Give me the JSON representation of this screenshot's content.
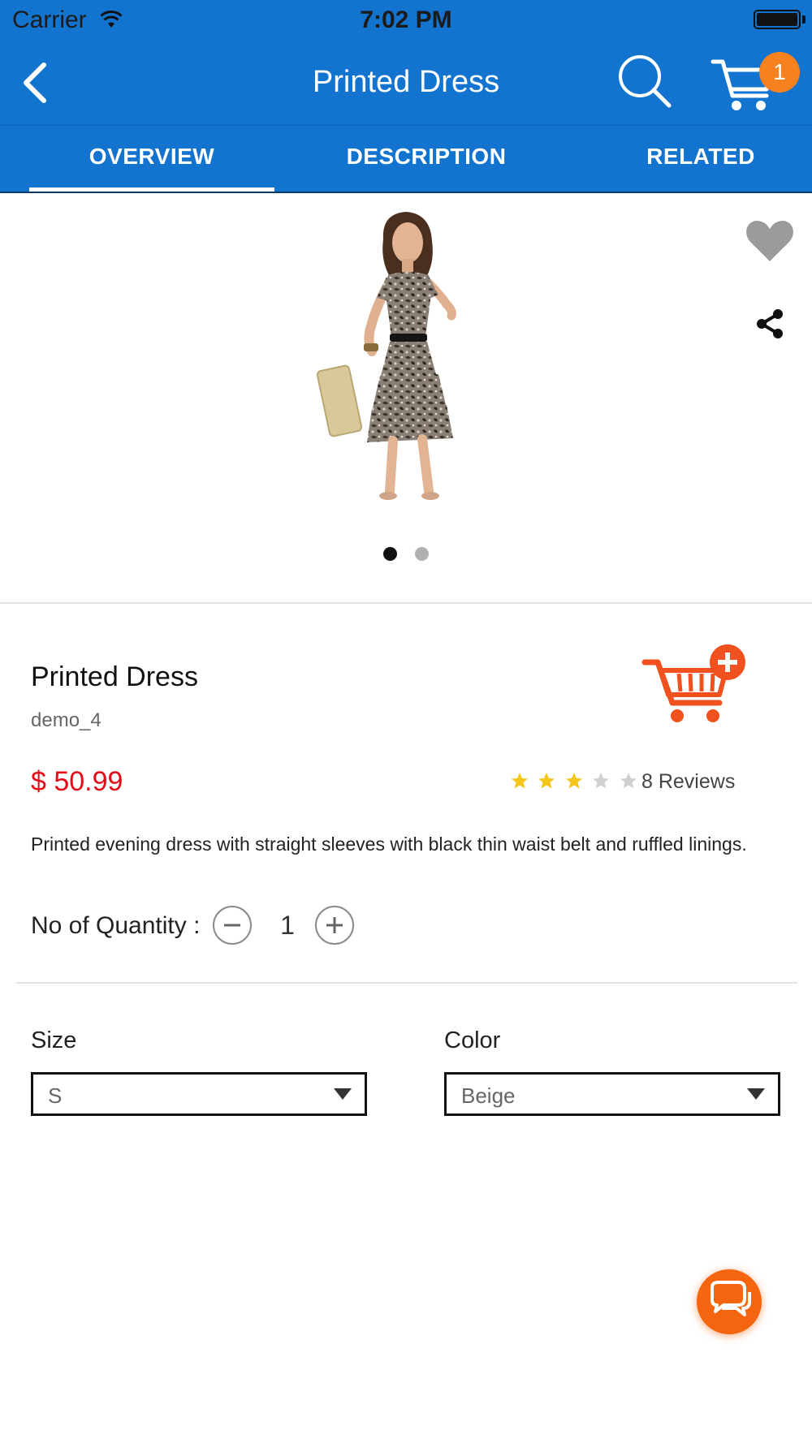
{
  "status_bar": {
    "carrier": "Carrier",
    "time": "7:02 PM"
  },
  "nav": {
    "title": "Printed Dress",
    "cart_count": "1"
  },
  "tabs": [
    {
      "label": "OVERVIEW",
      "active": true
    },
    {
      "label": "DESCRIPTION",
      "active": false
    },
    {
      "label": "RELATED",
      "active": false
    }
  ],
  "gallery": {
    "current_page": 1,
    "total_pages": 2
  },
  "product": {
    "name": "Printed Dress",
    "sku": "demo_4",
    "price": "$ 50.99",
    "rating": 3,
    "rating_max": 5,
    "reviews": "8 Reviews",
    "description": "Printed evening dress with straight sleeves with black thin waist belt and ruffled linings."
  },
  "quantity": {
    "label": "No of Quantity :",
    "value": "1"
  },
  "options": {
    "size": {
      "label": "Size",
      "value": "S"
    },
    "color": {
      "label": "Color",
      "value": "Beige"
    }
  },
  "colors": {
    "header": "#1374cf",
    "badge": "#f5821f",
    "price": "#e30b17",
    "cart_add": "#f0511f",
    "star_on": "#f5c518",
    "star_off": "#d0d0d0",
    "chat": "#f5640e"
  },
  "icons": [
    "back-icon",
    "search-icon",
    "cart-icon",
    "heart-icon",
    "share-icon",
    "add-to-cart-icon",
    "minus-icon",
    "plus-icon",
    "dropdown-arrow-icon",
    "chat-icon"
  ]
}
